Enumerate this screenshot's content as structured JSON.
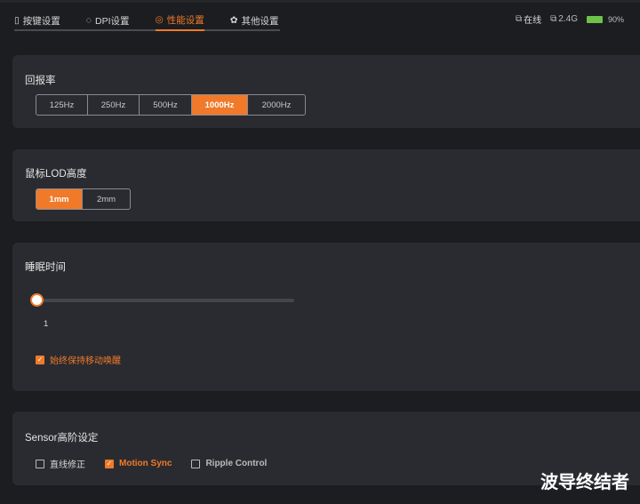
{
  "tabs": [
    {
      "label": "按键设置",
      "icon": "mouse-icon"
    },
    {
      "label": "DPI设置",
      "icon": "crosshair-icon"
    },
    {
      "label": "性能设置",
      "icon": "performance-icon"
    },
    {
      "label": "其他设置",
      "icon": "gear-icon"
    }
  ],
  "active_tab": 2,
  "status": {
    "connection": "在线",
    "mode": "2.4G",
    "battery": "90%",
    "battery_percent": 90
  },
  "polling": {
    "title": "回报率",
    "options": [
      "125Hz",
      "250Hz",
      "500Hz",
      "1000Hz",
      "2000Hz"
    ],
    "selected": "1000Hz"
  },
  "lod": {
    "title": "鼠标LOD高度",
    "options": [
      "1mm",
      "2mm"
    ],
    "selected": "1mm"
  },
  "sleep": {
    "title": "睡眠时间",
    "value": "1",
    "slider_fraction": 0,
    "keep_awake": "始终保持移动唤醒",
    "keep_awake_checked": true
  },
  "sensor": {
    "title": "Sensor高阶设定",
    "options": [
      {
        "label": "直线修正",
        "checked": false
      },
      {
        "label": "Motion Sync",
        "checked": true
      },
      {
        "label": "Ripple Control",
        "checked": false
      }
    ]
  },
  "watermark": "波导终结者",
  "colors": {
    "accent": "#f07a2a",
    "battery": "#6cc24a"
  }
}
